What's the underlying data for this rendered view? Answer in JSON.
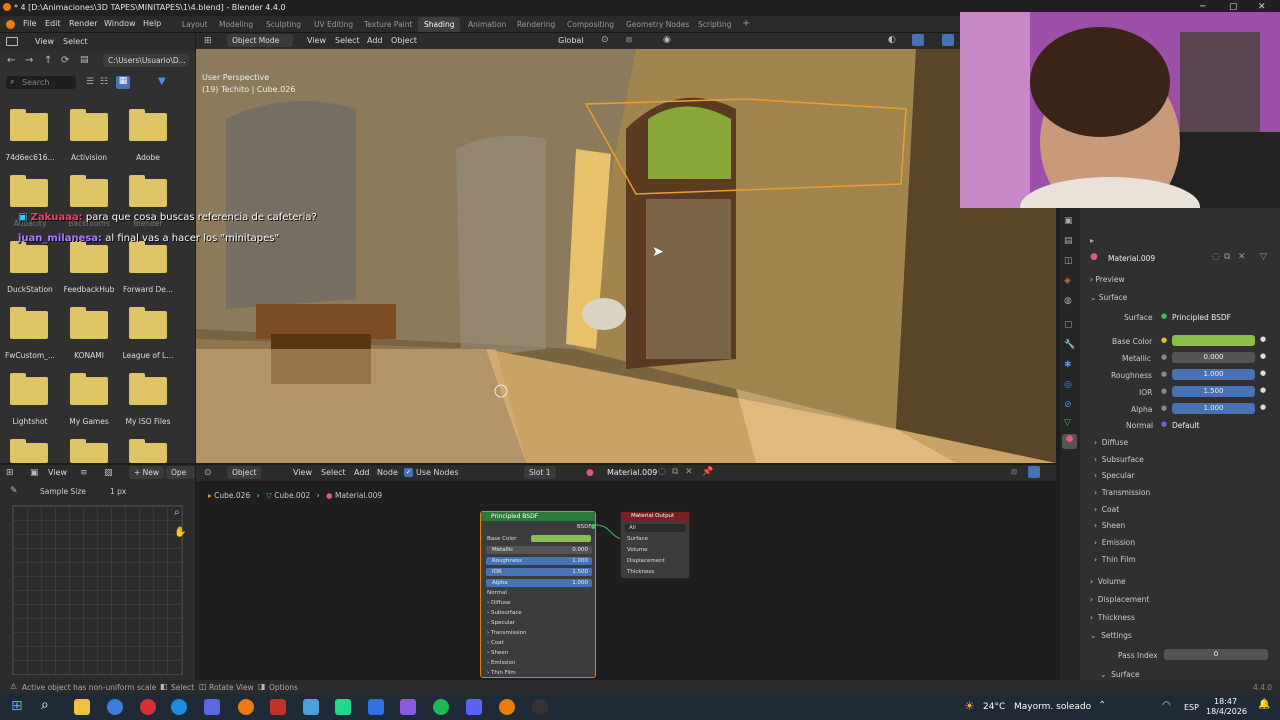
{
  "window": {
    "title": "* 4 [D:\\Animaciones\\3D TAPES\\MINITAPES\\1\\4.blend] - Blender 4.4.0"
  },
  "menu": [
    "File",
    "Edit",
    "Render",
    "Window",
    "Help"
  ],
  "workspaces": [
    "Layout",
    "Modeling",
    "Sculpting",
    "UV Editing",
    "Texture Paint",
    "Shading",
    "Animation",
    "Rendering",
    "Compositing",
    "Geometry Nodes",
    "Scripting"
  ],
  "active_workspace": "Shading",
  "file_browser": {
    "view": "View",
    "select": "Select",
    "path": "C:\\Users\\Usuario\\D...",
    "search_placeholder": "Search",
    "folders": [
      "74d6ec616...",
      "Activision",
      "Adobe",
      "Audacity",
      "Backrooms",
      "Blender",
      "DuckStation",
      "FeedbackHub",
      "Forward De...",
      "FwCustom_...",
      "KONAMI",
      "League of L...",
      "Lightshot",
      "My Games",
      "My ISO Files"
    ]
  },
  "viewport": {
    "mode": "Object Mode",
    "view": "View",
    "select": "Select",
    "add": "Add",
    "object": "Object",
    "orientation": "Global",
    "perspective": "User Perspective",
    "collection": "(19) Techito | Cube.026"
  },
  "chat": [
    {
      "user": "Zakuaaa:",
      "message": "para que cosa buscas referencia de cafeteria?",
      "color": "#ff3b6b"
    },
    {
      "user": "juan_milanesa:",
      "message": "al final vas a hacer los \"minitapes\"",
      "color": "#b07cff"
    }
  ],
  "image_editor": {
    "view": "View",
    "new": "New",
    "open": "Ope",
    "sample_size_label": "Sample Size",
    "sample_size_value": "1 px"
  },
  "node_editor": {
    "object": "Object",
    "view": "View",
    "select": "Select",
    "add": "Add",
    "node": "Node",
    "use_nodes": "Use Nodes",
    "slot": "Slot 1",
    "material": "Material.009",
    "breadcrumb": [
      "Cube.026",
      "Cube.002",
      "Material.009"
    ]
  },
  "bsdf_node": {
    "title": "Principled BSDF",
    "output": "BSDF",
    "rows": [
      {
        "label": "Base Color",
        "value": ""
      },
      {
        "label": "Metallic",
        "value": "0.000"
      },
      {
        "label": "Roughness",
        "value": "1.000"
      },
      {
        "label": "IOR",
        "value": "1.500"
      },
      {
        "label": "Alpha",
        "value": "1.000"
      }
    ],
    "normal": "Normal",
    "sections": [
      "Diffuse",
      "Subsurface",
      "Specular",
      "Transmission",
      "Coat",
      "Sheen",
      "Emission",
      "Thin Film"
    ]
  },
  "output_node": {
    "title": "Material Output",
    "target": "All",
    "inputs": [
      "Surface",
      "Volume",
      "Displacement",
      "Thickness"
    ]
  },
  "properties": {
    "material": "Material.009",
    "preview": "Preview",
    "surface_section": "Surface",
    "surface_label": "Surface",
    "surface_value": "Principled BSDF",
    "base_color_label": "Base Color",
    "base_color": "#8cbf4a",
    "metallic_label": "Metallic",
    "metallic": "0.000",
    "roughness_label": "Roughness",
    "roughness": "1.000",
    "ior_label": "IOR",
    "ior": "1.500",
    "alpha_label": "Alpha",
    "alpha": "1.000",
    "normal_label": "Normal",
    "normal": "Default",
    "subsections": [
      "Diffuse",
      "Subsurface",
      "Specular",
      "Transmission",
      "Coat",
      "Sheen",
      "Emission",
      "Thin Film"
    ],
    "volume": "Volume",
    "displacement": "Displacement",
    "thickness": "Thickness",
    "settings": "Settings",
    "pass_index_label": "Pass Index",
    "pass_index": "0",
    "settings_surface": "Surface"
  },
  "statusbar": {
    "message": "Active object has non-uniform scale",
    "select": "Select",
    "rotate": "Rotate View",
    "options": "Options",
    "version": "4.4.0"
  },
  "taskbar": {
    "weather_temp": "24°C",
    "weather_desc": "Mayorm. soleado",
    "lang": "ESP",
    "time": "18:47",
    "date": "18/4/2026"
  }
}
